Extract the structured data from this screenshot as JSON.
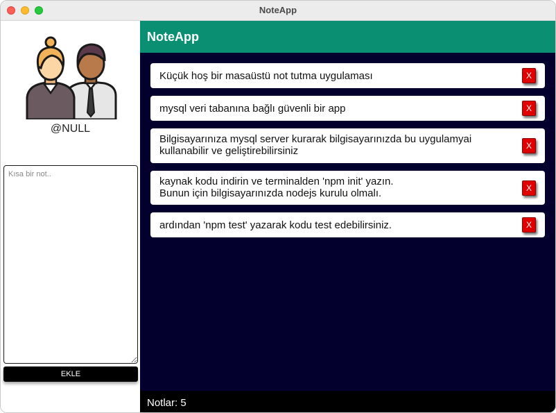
{
  "window": {
    "title": "NoteApp"
  },
  "sidebar": {
    "username": "@NULL",
    "note_input": {
      "value": "",
      "placeholder": "Kısa bir not.."
    },
    "add_button_label": "EKLE"
  },
  "main": {
    "header_title": "NoteApp",
    "delete_label": "X",
    "notes": [
      {
        "text": "Küçük hoş bir masaüstü not tutma uygulaması"
      },
      {
        "text": "mysql veri tabanına bağlı güvenli bir app"
      },
      {
        "text": "Bilgisayarınıza mysql server kurarak bilgisayarınızda bu uygulamyai\nkullanabilir ve geliştirebilirsiniz"
      },
      {
        "text": "kaynak kodu indirin ve terminalden 'npm init' yazın.\nBunun için bilgisayarınızda nodejs kurulu olmalı."
      },
      {
        "text": "ardından 'npm test' yazarak kodu test edebilirsiniz."
      }
    ],
    "footer_text": "Notlar: 5"
  },
  "colors": {
    "header": "#0a8f73",
    "main_background": "#03002e",
    "delete_button": "#e00000",
    "footer": "#000000"
  }
}
